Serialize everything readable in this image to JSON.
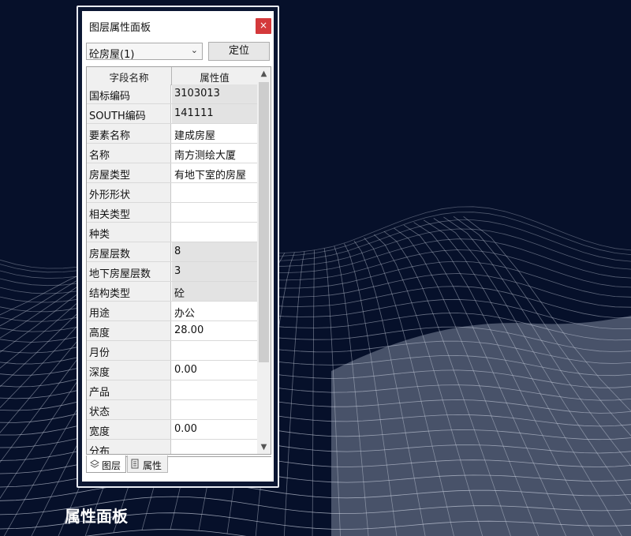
{
  "panel": {
    "title": "图层属性面板",
    "close_label": "×",
    "layer_select": {
      "value": "砼房屋(1)",
      "chevron": "⌄"
    },
    "locate_label": "定位",
    "columns": [
      "字段名称",
      "属性值"
    ],
    "rows": [
      {
        "field": "国标编码",
        "value": "3103013",
        "shaded": true
      },
      {
        "field": "SOUTH编码",
        "value": "141111",
        "shaded": true
      },
      {
        "field": "要素名称",
        "value": "建成房屋",
        "shaded": false
      },
      {
        "field": "名称",
        "value": "南方测绘大厦",
        "shaded": false
      },
      {
        "field": "房屋类型",
        "value": "有地下室的房屋",
        "shaded": false
      },
      {
        "field": "外形形状",
        "value": "",
        "shaded": false
      },
      {
        "field": "相关类型",
        "value": "",
        "shaded": false
      },
      {
        "field": "种类",
        "value": "",
        "shaded": false
      },
      {
        "field": "房屋层数",
        "value": "8",
        "shaded": true
      },
      {
        "field": "地下房屋层数",
        "value": "3",
        "shaded": true
      },
      {
        "field": "结构类型",
        "value": "砼",
        "shaded": true
      },
      {
        "field": "用途",
        "value": "办公",
        "shaded": false
      },
      {
        "field": "高度",
        "value": "28.00",
        "shaded": false
      },
      {
        "field": "月份",
        "value": "",
        "shaded": false
      },
      {
        "field": "深度",
        "value": "0.00",
        "shaded": false
      },
      {
        "field": "产品",
        "value": "",
        "shaded": false
      },
      {
        "field": "状态",
        "value": "",
        "shaded": false
      },
      {
        "field": "宽度",
        "value": "0.00",
        "shaded": false
      },
      {
        "field": "分布",
        "value": "",
        "shaded": false
      }
    ],
    "scroll": {
      "up": "▲",
      "down": "▼"
    },
    "tabs": [
      {
        "label": "图层",
        "icon": "layers-icon",
        "active": true
      },
      {
        "label": "属性",
        "icon": "document-icon",
        "active": false
      }
    ]
  },
  "caption": "属性面板",
  "colors": {
    "background": "#06102a",
    "close": "#d4393b",
    "mesh": "#cfd5e3"
  }
}
